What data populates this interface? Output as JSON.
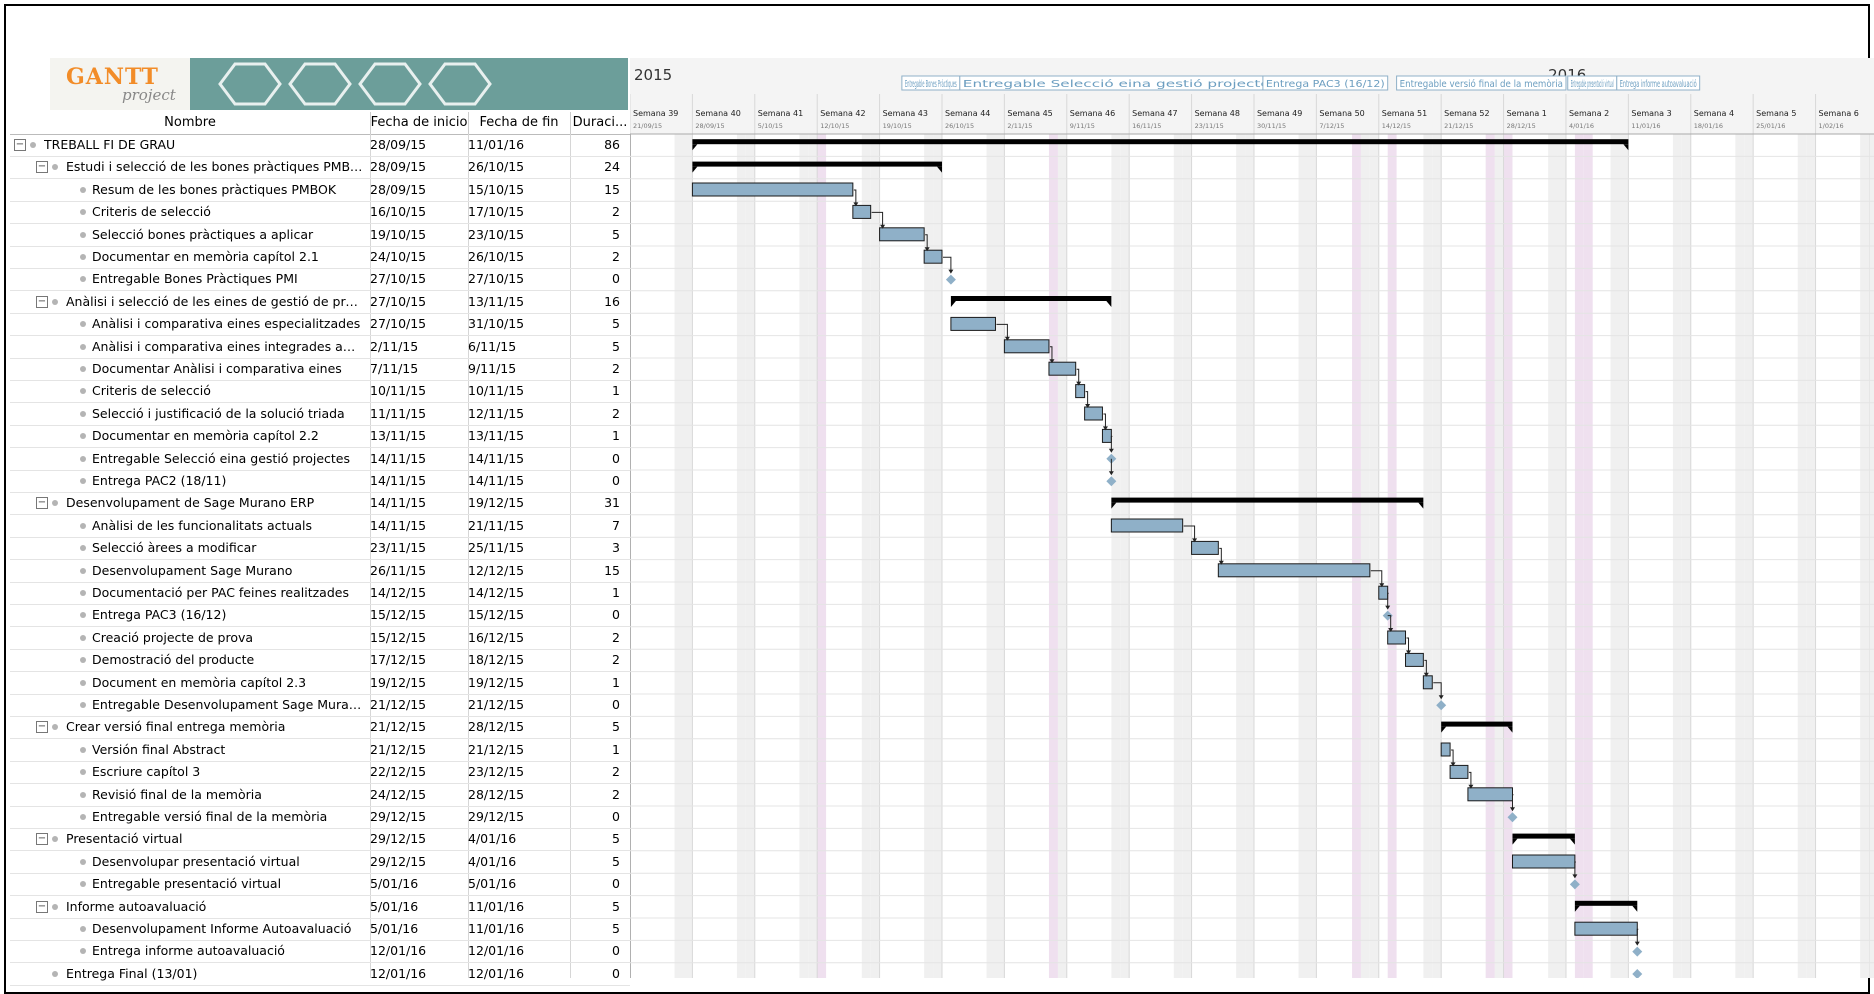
{
  "app": {
    "logo_text": "GANTT",
    "logo_sub": "project"
  },
  "columns": {
    "name": "Nombre",
    "start": "Fecha de inicio",
    "end": "Fecha de fin",
    "duration": "Duraci..."
  },
  "timeline": {
    "years": [
      {
        "label": "2015"
      },
      {
        "label": "2016"
      }
    ],
    "weeks": [
      "Semana 39",
      "Semana 40",
      "Semana 41",
      "Semana 42",
      "Semana 43",
      "Semana 44",
      "Semana 45",
      "Semana 46",
      "Semana 47",
      "Semana 48",
      "Semana 49",
      "Semana 50",
      "Semana 51",
      "Semana 52",
      "Semana 1",
      "Semana 2",
      "Semana 3",
      "Semana 4",
      "Semana 5",
      "Semana 6"
    ],
    "week_dates": [
      "21/09/15",
      "28/09/15",
      "5/10/15",
      "12/10/15",
      "19/10/15",
      "26/10/15",
      "2/11/15",
      "9/11/15",
      "16/11/15",
      "23/11/15",
      "30/11/15",
      "7/12/15",
      "14/12/15",
      "21/12/15",
      "28/12/15",
      "4/01/16",
      "11/01/16",
      "18/01/16",
      "25/01/16",
      "1/02/16"
    ],
    "milestone_labels": [
      "Entregable Bones Pràctiques",
      "Entregable Selecció eina gestió projectes",
      "Entrega PAC3 (16/12)",
      "Entregable versió final de la memòria",
      "Entregable presentació virtual",
      "Entrega informe autoavaluació"
    ],
    "colors": {
      "bar": "#8fb0c8",
      "bar_border": "#1a1a1a",
      "summary": "#000000",
      "milestone": "#8fb0c8",
      "weekend": "#f0f0f0",
      "highlight": "#efe0ef",
      "grid": "#d8d8d8"
    }
  },
  "tasks": [
    {
      "level": 0,
      "toggle": "minus",
      "name": "TREBALL FI DE GRAU",
      "start": "28/09/15",
      "end": "11/01/16",
      "duration": "86",
      "type": "summary",
      "s": 7,
      "e": 112
    },
    {
      "level": 1,
      "toggle": "minus",
      "name": "Estudi i selecció de les bones pràctiques PMBOK",
      "start": "28/09/15",
      "end": "26/10/15",
      "duration": "24",
      "type": "summary",
      "s": 7,
      "e": 35
    },
    {
      "level": 2,
      "name": "Resum de les bones pràctiques PMBOK",
      "start": "28/09/15",
      "end": "15/10/15",
      "duration": "15",
      "type": "task",
      "s": 7,
      "e": 25
    },
    {
      "level": 2,
      "name": "Criteris de selecció",
      "start": "16/10/15",
      "end": "17/10/15",
      "duration": "2",
      "type": "task",
      "s": 25,
      "e": 27
    },
    {
      "level": 2,
      "name": "Selecció bones pràctiques a aplicar",
      "start": "19/10/15",
      "end": "23/10/15",
      "duration": "5",
      "type": "task",
      "s": 28,
      "e": 33
    },
    {
      "level": 2,
      "name": "Documentar en memòria capítol 2.1",
      "start": "24/10/15",
      "end": "26/10/15",
      "duration": "2",
      "type": "task",
      "s": 33,
      "e": 35
    },
    {
      "level": 2,
      "name": "Entregable Bones Pràctiques PMI",
      "start": "27/10/15",
      "end": "27/10/15",
      "duration": "0",
      "type": "milestone",
      "s": 36,
      "e": 36
    },
    {
      "level": 1,
      "toggle": "minus",
      "name": "Anàlisi i selecció de les eines de gestió de projec...",
      "start": "27/10/15",
      "end": "13/11/15",
      "duration": "16",
      "type": "summary",
      "s": 36,
      "e": 54
    },
    {
      "level": 2,
      "name": "Anàlisi i comparativa eines especialitzades",
      "start": "27/10/15",
      "end": "31/10/15",
      "duration": "5",
      "type": "task",
      "s": 36,
      "e": 41
    },
    {
      "level": 2,
      "name": "Anàlisi i comparativa eines integrades amb ...",
      "start": "2/11/15",
      "end": "6/11/15",
      "duration": "5",
      "type": "task",
      "s": 42,
      "e": 47
    },
    {
      "level": 2,
      "name": "Documentar Anàlisi i comparativa eines",
      "start": "7/11/15",
      "end": "9/11/15",
      "duration": "2",
      "type": "task",
      "s": 47,
      "e": 50
    },
    {
      "level": 2,
      "name": "Criteris de selecció",
      "start": "10/11/15",
      "end": "10/11/15",
      "duration": "1",
      "type": "task",
      "s": 50,
      "e": 51
    },
    {
      "level": 2,
      "name": "Selecció i justificació de la solució triada",
      "start": "11/11/15",
      "end": "12/11/15",
      "duration": "2",
      "type": "task",
      "s": 51,
      "e": 53
    },
    {
      "level": 2,
      "name": "Documentar en memòria capítol 2.2",
      "start": "13/11/15",
      "end": "13/11/15",
      "duration": "1",
      "type": "task",
      "s": 53,
      "e": 54
    },
    {
      "level": 2,
      "name": "Entregable Selecció eina gestió projectes",
      "start": "14/11/15",
      "end": "14/11/15",
      "duration": "0",
      "type": "milestone",
      "s": 54,
      "e": 54
    },
    {
      "level": 2,
      "name": "Entrega PAC2 (18/11)",
      "start": "14/11/15",
      "end": "14/11/15",
      "duration": "0",
      "type": "milestone",
      "s": 54,
      "e": 54
    },
    {
      "level": 1,
      "toggle": "minus",
      "name": "Desenvolupament de Sage Murano ERP",
      "start": "14/11/15",
      "end": "19/12/15",
      "duration": "31",
      "type": "summary",
      "s": 54,
      "e": 89
    },
    {
      "level": 2,
      "name": "Anàlisi de les funcionalitats actuals",
      "start": "14/11/15",
      "end": "21/11/15",
      "duration": "7",
      "type": "task",
      "s": 54,
      "e": 62
    },
    {
      "level": 2,
      "name": "Selecció àrees a modificar",
      "start": "23/11/15",
      "end": "25/11/15",
      "duration": "3",
      "type": "task",
      "s": 63,
      "e": 66
    },
    {
      "level": 2,
      "name": "Desenvolupament Sage Murano",
      "start": "26/11/15",
      "end": "12/12/15",
      "duration": "15",
      "type": "task",
      "s": 66,
      "e": 83
    },
    {
      "level": 2,
      "name": "Documentació per PAC feines realitzades",
      "start": "14/12/15",
      "end": "14/12/15",
      "duration": "1",
      "type": "task",
      "s": 84,
      "e": 85
    },
    {
      "level": 2,
      "name": "Entrega PAC3 (16/12)",
      "start": "15/12/15",
      "end": "15/12/15",
      "duration": "0",
      "type": "milestone",
      "s": 85,
      "e": 85
    },
    {
      "level": 2,
      "name": "Creació projecte de prova",
      "start": "15/12/15",
      "end": "16/12/15",
      "duration": "2",
      "type": "task",
      "s": 85,
      "e": 87
    },
    {
      "level": 2,
      "name": "Demostració del producte",
      "start": "17/12/15",
      "end": "18/12/15",
      "duration": "2",
      "type": "task",
      "s": 87,
      "e": 89
    },
    {
      "level": 2,
      "name": "Document en memòria capítol 2.3",
      "start": "19/12/15",
      "end": "19/12/15",
      "duration": "1",
      "type": "task",
      "s": 89,
      "e": 90
    },
    {
      "level": 2,
      "name": "Entregable Desenvolupament Sage Murano",
      "start": "21/12/15",
      "end": "21/12/15",
      "duration": "0",
      "type": "milestone",
      "s": 91,
      "e": 91
    },
    {
      "level": 1,
      "toggle": "minus",
      "name": "Crear versió final entrega memòria",
      "start": "21/12/15",
      "end": "28/12/15",
      "duration": "5",
      "type": "summary",
      "s": 91,
      "e": 99
    },
    {
      "level": 2,
      "name": "Versión final Abstract",
      "start": "21/12/15",
      "end": "21/12/15",
      "duration": "1",
      "type": "task",
      "s": 91,
      "e": 92
    },
    {
      "level": 2,
      "name": "Escriure capítol 3",
      "start": "22/12/15",
      "end": "23/12/15",
      "duration": "2",
      "type": "task",
      "s": 92,
      "e": 94
    },
    {
      "level": 2,
      "name": "Revisió final de la memòria",
      "start": "24/12/15",
      "end": "28/12/15",
      "duration": "2",
      "type": "task",
      "s": 94,
      "e": 99
    },
    {
      "level": 2,
      "name": "Entregable versió final de la memòria",
      "start": "29/12/15",
      "end": "29/12/15",
      "duration": "0",
      "type": "milestone",
      "s": 99,
      "e": 99
    },
    {
      "level": 1,
      "toggle": "minus",
      "name": "Presentació virtual",
      "start": "29/12/15",
      "end": "4/01/16",
      "duration": "5",
      "type": "summary",
      "s": 99,
      "e": 106
    },
    {
      "level": 2,
      "name": "Desenvolupar presentació virtual",
      "start": "29/12/15",
      "end": "4/01/16",
      "duration": "5",
      "type": "task",
      "s": 99,
      "e": 106
    },
    {
      "level": 2,
      "name": "Entregable presentació virtual",
      "start": "5/01/16",
      "end": "5/01/16",
      "duration": "0",
      "type": "milestone",
      "s": 106,
      "e": 106
    },
    {
      "level": 1,
      "toggle": "minus",
      "name": "Informe autoavaluació",
      "start": "5/01/16",
      "end": "11/01/16",
      "duration": "5",
      "type": "summary",
      "s": 106,
      "e": 113
    },
    {
      "level": 2,
      "name": "Desenvolupament Informe Autoavaluació",
      "start": "5/01/16",
      "end": "11/01/16",
      "duration": "5",
      "type": "task",
      "s": 106,
      "e": 113
    },
    {
      "level": 2,
      "name": "Entrega informe autoavaluació",
      "start": "12/01/16",
      "end": "12/01/16",
      "duration": "0",
      "type": "milestone",
      "s": 113,
      "e": 113
    },
    {
      "level": 1,
      "name": "Entrega Final (13/01)",
      "start": "12/01/16",
      "end": "12/01/16",
      "duration": "0",
      "type": "milestone",
      "s": 113,
      "e": 113
    }
  ]
}
